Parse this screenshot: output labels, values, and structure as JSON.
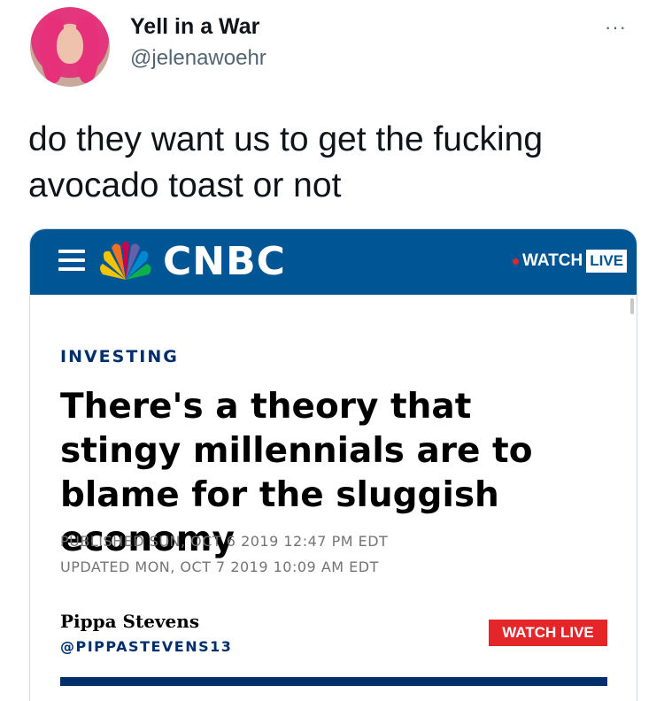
{
  "tweet": {
    "display_name": "Yell in a War",
    "handle": "@jelenawoehr",
    "more_label": "···",
    "text": "do they want us to get the fucking avocado toast or not"
  },
  "article_card": {
    "brand": "CNBC",
    "brand_color": "#005594",
    "accent_red": "#e4262b",
    "top_watch": "WATCH",
    "top_live": "LIVE",
    "section": "INVESTING",
    "headline": "There's a theory that stingy millennials are to blame for the sluggish economy",
    "published": "PUBLISHED SUN, OCT 6 2019 12:47 PM EDT",
    "updated": "UPDATED MON, OCT 7 2019 10:09 AM EDT",
    "author": "Pippa Stevens",
    "author_handle": "@PIPPASTEVENS13",
    "watch_live_button": "WATCH LIVE",
    "icons": [
      "menu-icon",
      "peacock-logo-icon",
      "live-dot-icon"
    ]
  }
}
